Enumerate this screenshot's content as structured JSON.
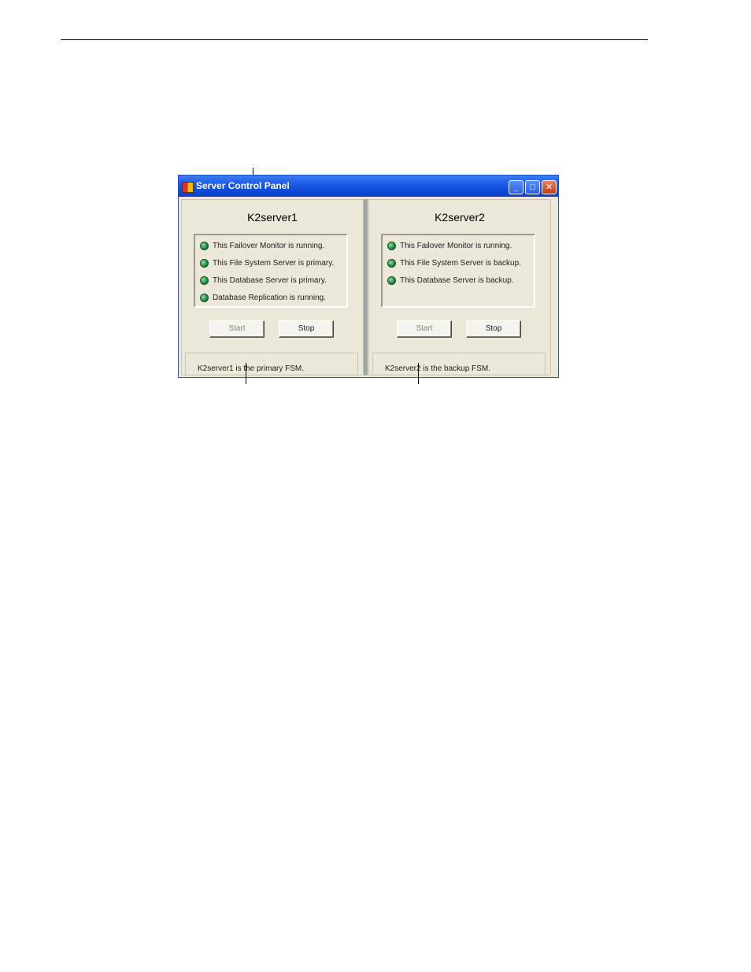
{
  "window": {
    "title": "Server Control Panel",
    "minimize_glyph": "_",
    "maximize_glyph": "□",
    "close_glyph": "✕",
    "icon": "app-icon"
  },
  "servers": [
    {
      "name": "K2server1",
      "statuses": [
        "This Failover Monitor is running.",
        "This File System Server is primary.",
        "This Database Server is primary.",
        "Database Replication is running."
      ],
      "start_label": "Start",
      "stop_label": "Stop",
      "message": "K2server1 is the primary FSM."
    },
    {
      "name": "K2server2",
      "statuses": [
        "This Failover Monitor is running.",
        "This File System Server is backup.",
        "This Database Server is backup."
      ],
      "start_label": "Start",
      "stop_label": "Stop",
      "message": "K2server2 is the backup FSM."
    }
  ],
  "colors": {
    "titlebar": "#0a46d4",
    "status_led": "#1a8a3a",
    "panel_bg": "#ebe7d9"
  }
}
